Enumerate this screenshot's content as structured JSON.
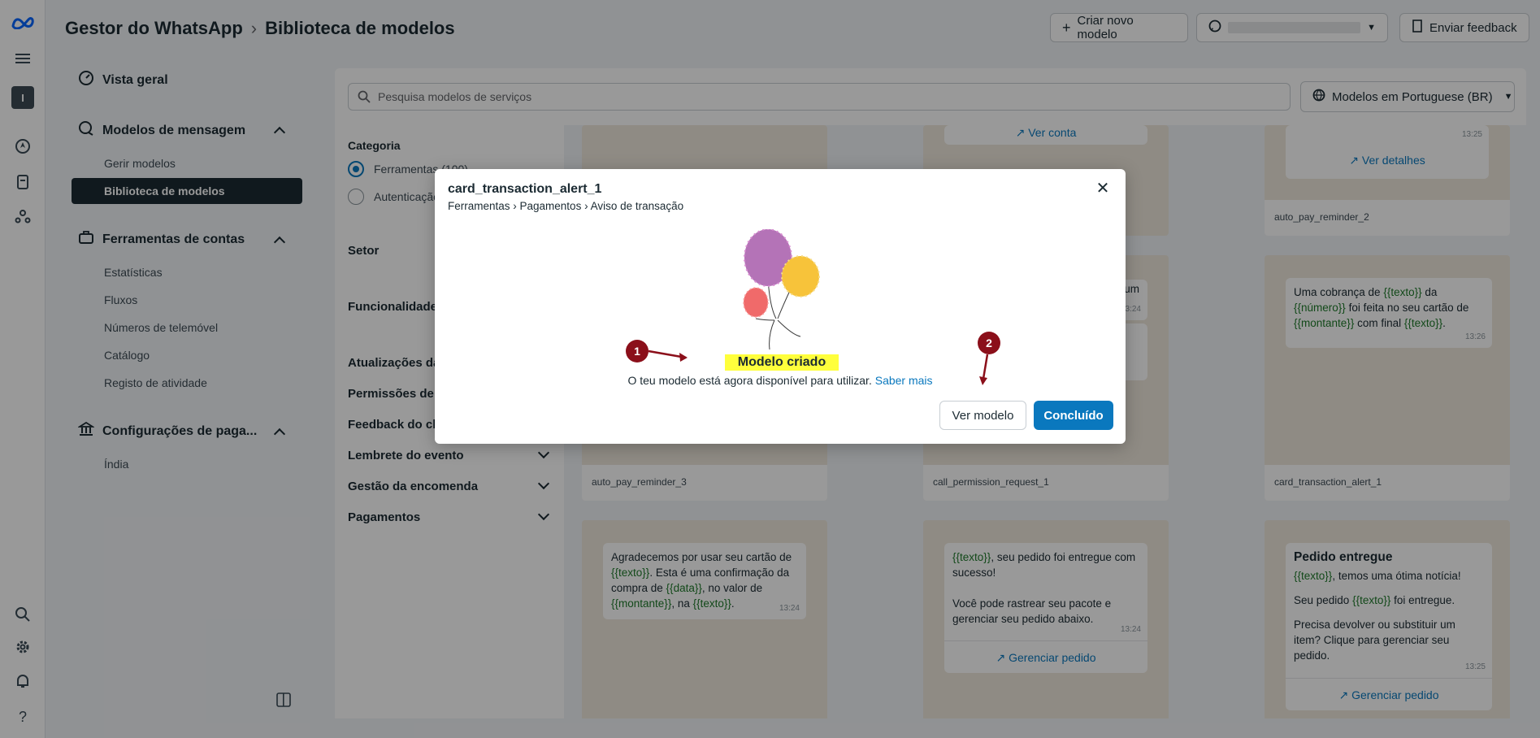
{
  "header": {
    "app": "Gestor do WhatsApp",
    "page": "Biblioteca de modelos",
    "create_button": "Criar novo modelo",
    "feedback_button": "Enviar feedback"
  },
  "rail": {
    "avatar": "I",
    "help": "?"
  },
  "sidebar": {
    "overview": "Vista geral",
    "messages_section": "Modelos de mensagem",
    "manage_models": "Gerir modelos",
    "library": "Biblioteca de modelos",
    "tools_section": "Ferramentas de contas",
    "tools_items": [
      "Estatísticas",
      "Fluxos",
      "Números de telemóvel",
      "Catálogo",
      "Registo de atividade"
    ],
    "payments_section": "Configurações de paga...",
    "payments_items": [
      "Índia"
    ]
  },
  "search": {
    "placeholder": "Pesquisa modelos de serviços"
  },
  "language": "Modelos em Portuguese (BR)",
  "filters": {
    "category_label": "Categoria",
    "options": [
      "Ferramentas (100)",
      "Autenticação"
    ],
    "sections": [
      "Setor",
      "Funcionalidade",
      "Atualizações da",
      "Permissões de",
      "Feedback do cl",
      "Lembrete do evento",
      "Gestão da encomenda",
      "Pagamentos"
    ]
  },
  "cards": {
    "row1": {
      "c1_link": "Ver conta",
      "c3_time": "13:25",
      "c3_link": "Ver detalhes",
      "c3_name": "auto_pay_reminder_2",
      "c2_time": "13:24",
      "c2_frag": "um"
    },
    "row2": {
      "c1_name": "auto_pay_reminder_3",
      "c2_name": "call_permission_request_1",
      "c3_name": "card_transaction_alert_1",
      "c3_time": "13:26",
      "c3_p1": "Uma cobrança de ",
      "c3_v1": "{{texto}}",
      "c3_p2": " da ",
      "c3_v2": "{{número}}",
      "c3_p3": " foi feita no seu cartão de ",
      "c3_v3": "{{montante}}",
      "c3_p4": " com final ",
      "c3_v4": "{{texto}}",
      "c3_p5": "."
    },
    "row3": {
      "c1_time": "13:24",
      "c1_p1": "Agradecemos por usar seu cartão de ",
      "c1_v1": "{{texto}}",
      "c1_p2": ". Esta é uma confirmação da compra de ",
      "c1_v2": "{{data}}",
      "c1_p3": ", no valor de ",
      "c1_v3": "{{montante}}",
      "c1_p4": ", na ",
      "c1_v4": "{{texto}}",
      "c1_p5": ".",
      "c2_v1": "{{texto}}",
      "c2_p1": ", seu pedido foi entregue com sucesso!",
      "c2_p2": "Você pode rastrear seu pacote e gerenciar seu pedido abaixo.",
      "c2_time": "13:24",
      "c2_link": "Gerenciar pedido",
      "c3_title": "Pedido entregue",
      "c3_v1": "{{texto}}",
      "c3_p1": ", temos uma ótima notícia!",
      "c3_p2a": "Seu pedido ",
      "c3_v2": "{{texto}}",
      "c3_p2b": " foi entregue.",
      "c3_p3": "Precisa devolver ou substituir um item? Clique para gerenciar seu pedido.",
      "c3_time": "13:25",
      "c3_link": "Gerenciar pedido"
    }
  },
  "modal": {
    "title": "card_transaction_alert_1",
    "path": "Ferramentas › Pagamentos › Aviso de transação",
    "heading": "Modelo criado",
    "message": "O teu modelo está agora disponível para utilizar.",
    "learn_more": "Saber mais",
    "view_button": "Ver modelo",
    "done_button": "Concluído",
    "close": "✕"
  },
  "annotations": [
    "1",
    "2"
  ],
  "colors": {
    "primary": "#0a78be",
    "annotation": "#8b0f1a",
    "highlight": "#ffff3c",
    "dark": "#1c2b33"
  }
}
